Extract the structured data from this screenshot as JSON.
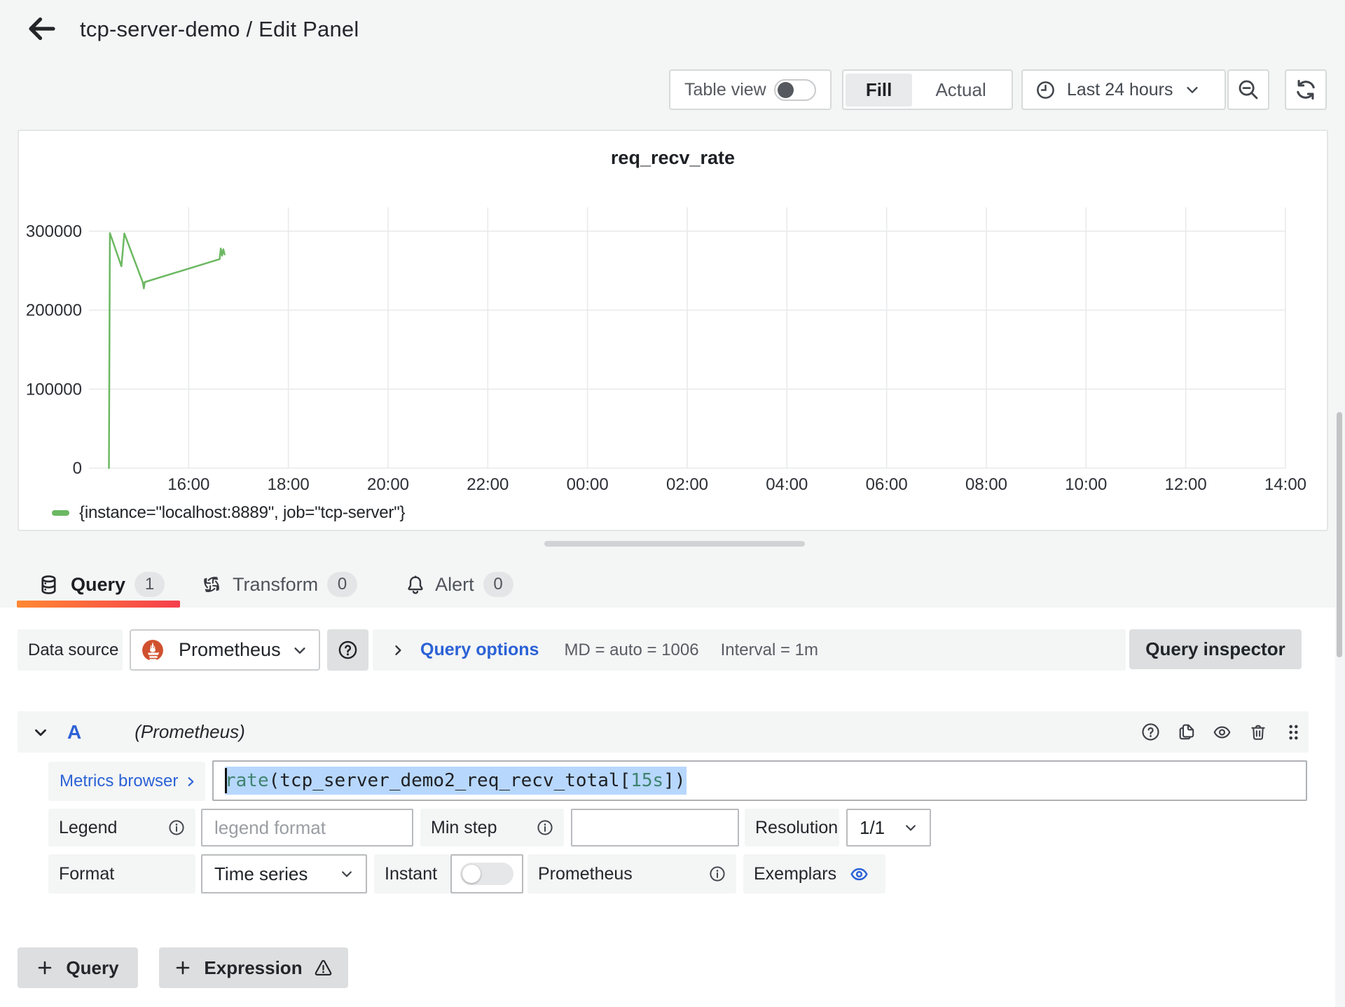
{
  "header": {
    "title": "tcp-server-demo / Edit Panel"
  },
  "toolbar": {
    "table_view_label": "Table view",
    "fill_label": "Fill",
    "actual_label": "Actual",
    "time_range_label": "Last 24 hours"
  },
  "panel": {
    "title": "req_recv_rate",
    "legend_label": "{instance=\"localhost:8889\", job=\"tcp-server\"}"
  },
  "chart_data": {
    "type": "line",
    "title": "req_recv_rate",
    "xlabel": "",
    "ylabel": "",
    "x_domain": [
      14.0,
      38.0
    ],
    "y_domain": [
      0,
      330000
    ],
    "grid": true,
    "legend_position": "bottom-left",
    "x_ticks": [
      {
        "v": 16,
        "label": "16:00"
      },
      {
        "v": 18,
        "label": "18:00"
      },
      {
        "v": 20,
        "label": "20:00"
      },
      {
        "v": 22,
        "label": "22:00"
      },
      {
        "v": 24,
        "label": "00:00"
      },
      {
        "v": 26,
        "label": "02:00"
      },
      {
        "v": 28,
        "label": "04:00"
      },
      {
        "v": 30,
        "label": "06:00"
      },
      {
        "v": 32,
        "label": "08:00"
      },
      {
        "v": 34,
        "label": "10:00"
      },
      {
        "v": 36,
        "label": "12:00"
      },
      {
        "v": 38,
        "label": "14:00"
      }
    ],
    "y_ticks": [
      {
        "v": 0,
        "label": "0"
      },
      {
        "v": 100000,
        "label": "100000"
      },
      {
        "v": 200000,
        "label": "200000"
      },
      {
        "v": 300000,
        "label": "300000"
      }
    ],
    "series": [
      {
        "name": "{instance=\"localhost:8889\", job=\"tcp-server\"}",
        "color": "#6cb862",
        "points": [
          [
            14.4,
            0
          ],
          [
            14.42,
            297500
          ],
          [
            14.65,
            255500
          ],
          [
            14.71,
            297000
          ],
          [
            15.08,
            235000
          ],
          [
            15.1,
            227500
          ],
          [
            15.12,
            235500
          ],
          [
            16.62,
            264500
          ],
          [
            16.645,
            278000
          ],
          [
            16.67,
            269000
          ],
          [
            16.695,
            277000
          ],
          [
            16.72,
            270500
          ]
        ]
      }
    ]
  },
  "tabs": {
    "query": {
      "label": "Query",
      "count": "1"
    },
    "transform": {
      "label": "Transform",
      "count": "0"
    },
    "alert": {
      "label": "Alert",
      "count": "0"
    }
  },
  "datasource_row": {
    "label": "Data source",
    "value": "Prometheus",
    "query_options_label": "Query options",
    "stat_md": "MD = auto = 1006",
    "stat_interval": "Interval = 1m",
    "inspector_label": "Query inspector"
  },
  "query_row": {
    "ref_id": "A",
    "datasource_hint": "(Prometheus)",
    "metrics_browser_label": "Metrics browser",
    "expression_tokens": [
      {
        "type": "fn",
        "text": "rate"
      },
      {
        "type": "punct",
        "text": "("
      },
      {
        "type": "metric",
        "text": "tcp_server_demo2_req_recv_total"
      },
      {
        "type": "punct",
        "text": "["
      },
      {
        "type": "duration",
        "text": "15s"
      },
      {
        "type": "punct",
        "text": "])"
      }
    ],
    "legend_label": "Legend",
    "legend_placeholder": "legend format",
    "min_step_label": "Min step",
    "resolution_label": "Resolution",
    "resolution_value": "1/1",
    "format_label": "Format",
    "format_value": "Time series",
    "instant_label": "Instant",
    "type_label": "Prometheus",
    "exemplars_label": "Exemplars"
  },
  "footer": {
    "add_query_label": "Query",
    "add_expression_label": "Expression"
  },
  "colors": {
    "accent_blue": "#2b62d6",
    "series_green": "#73bf69",
    "tab_gradient_start": "#ff8833",
    "tab_gradient_end": "#f53e4c",
    "prometheus_orange": "#de5038",
    "selection_blue": "#b7d7fd"
  }
}
